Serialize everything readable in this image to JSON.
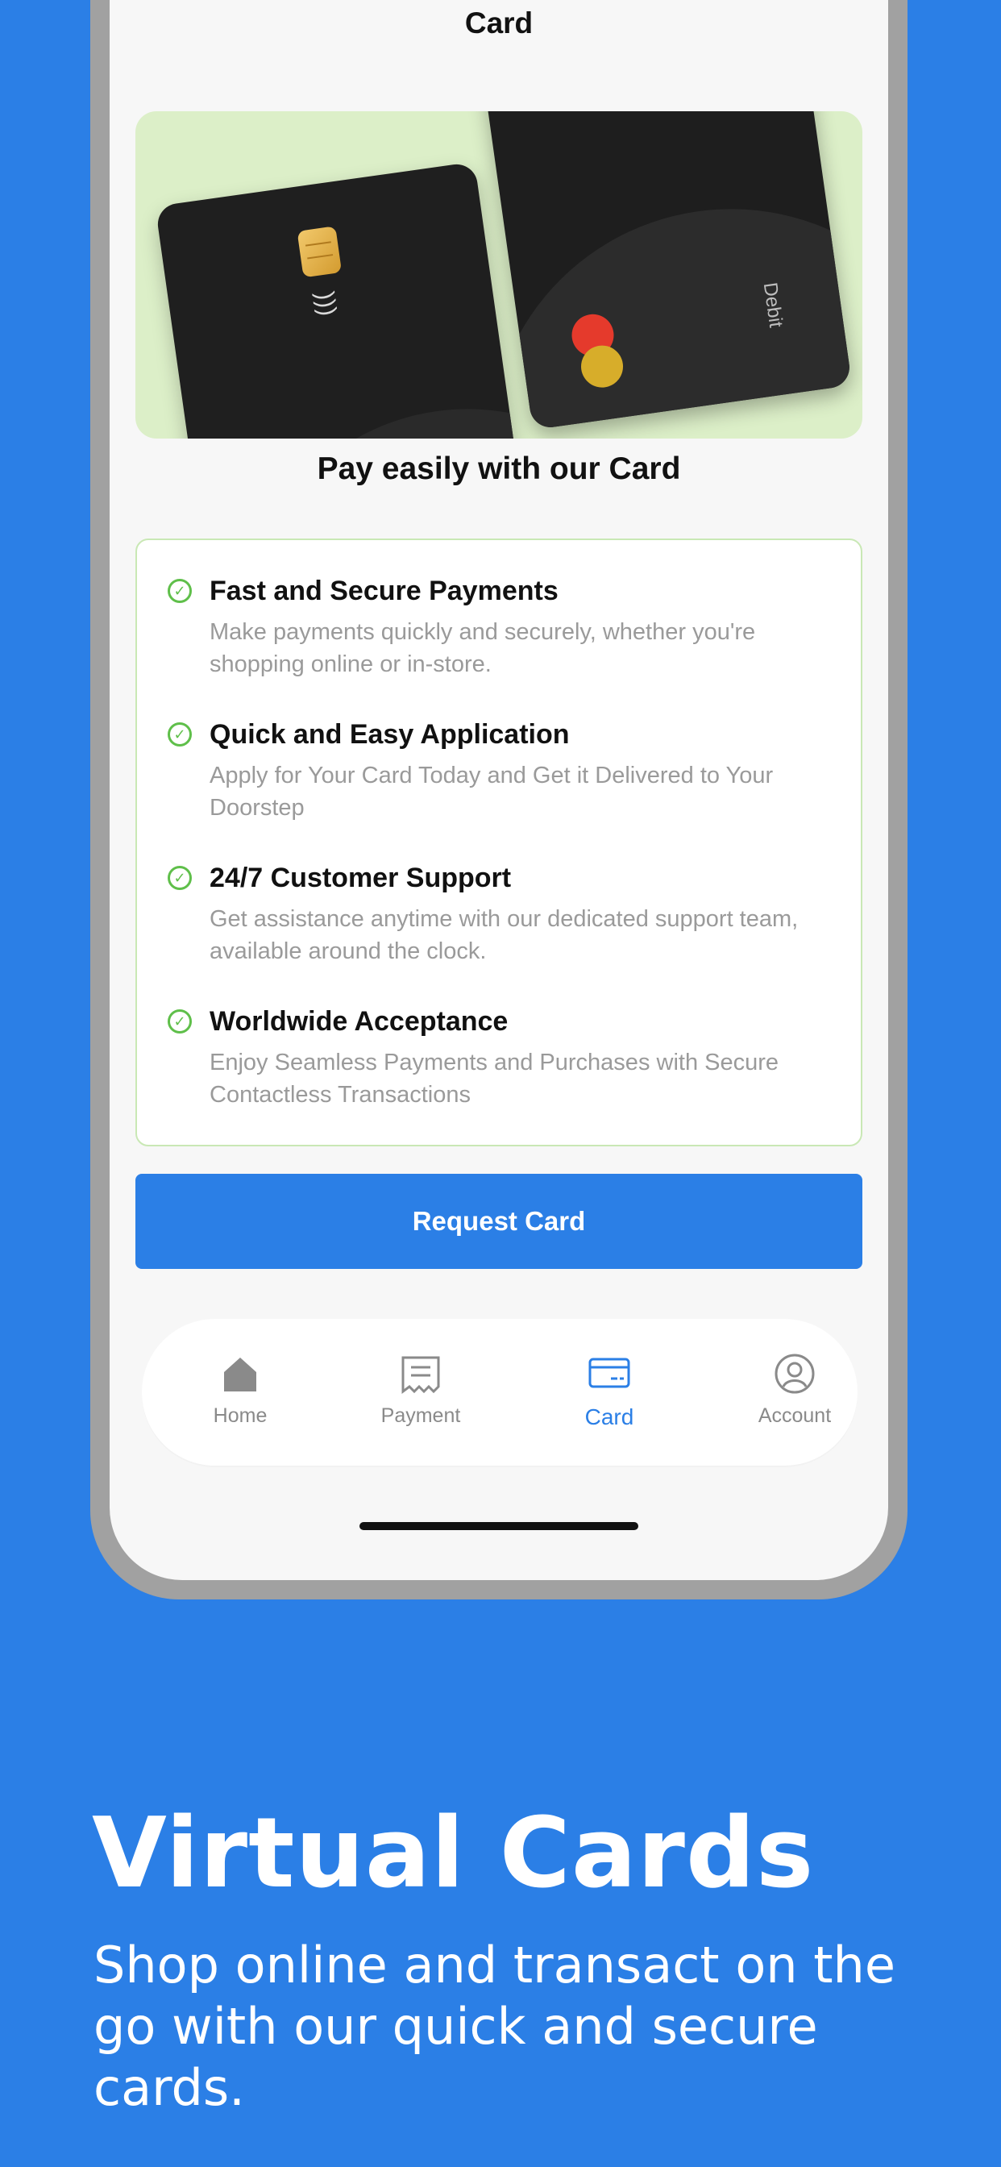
{
  "screen": {
    "title": "Card",
    "hero_card_label": "Debit",
    "subtitle": "Pay easily with our Card"
  },
  "features": [
    {
      "title": "Fast and Secure Payments",
      "description": "Make payments quickly and securely, whether you're shopping online or in-store."
    },
    {
      "title": "Quick and Easy Application",
      "description": "Apply for Your Card Today and Get it Delivered to Your Doorstep"
    },
    {
      "title": "24/7 Customer Support",
      "description": "Get assistance anytime with our dedicated support team, available around the clock."
    },
    {
      "title": "Worldwide Acceptance",
      "description": "Enjoy Seamless Payments and Purchases with Secure Contactless Transactions"
    }
  ],
  "cta": {
    "label": "Request Card"
  },
  "tabbar": {
    "items": [
      {
        "label": "Home",
        "icon": "home-icon",
        "active": false
      },
      {
        "label": "Payment",
        "icon": "receipt-icon",
        "active": false
      },
      {
        "label": "Card",
        "icon": "card-icon",
        "active": true
      },
      {
        "label": "Account",
        "icon": "account-icon",
        "active": false
      }
    ]
  },
  "marketing": {
    "headline": "Virtual Cards",
    "tagline": "Shop online and transact on the go with our quick and secure cards."
  },
  "colors": {
    "brand_blue": "#2B7FE6",
    "success_green": "#5FBF4A",
    "hero_bg": "#DCEFC8"
  }
}
